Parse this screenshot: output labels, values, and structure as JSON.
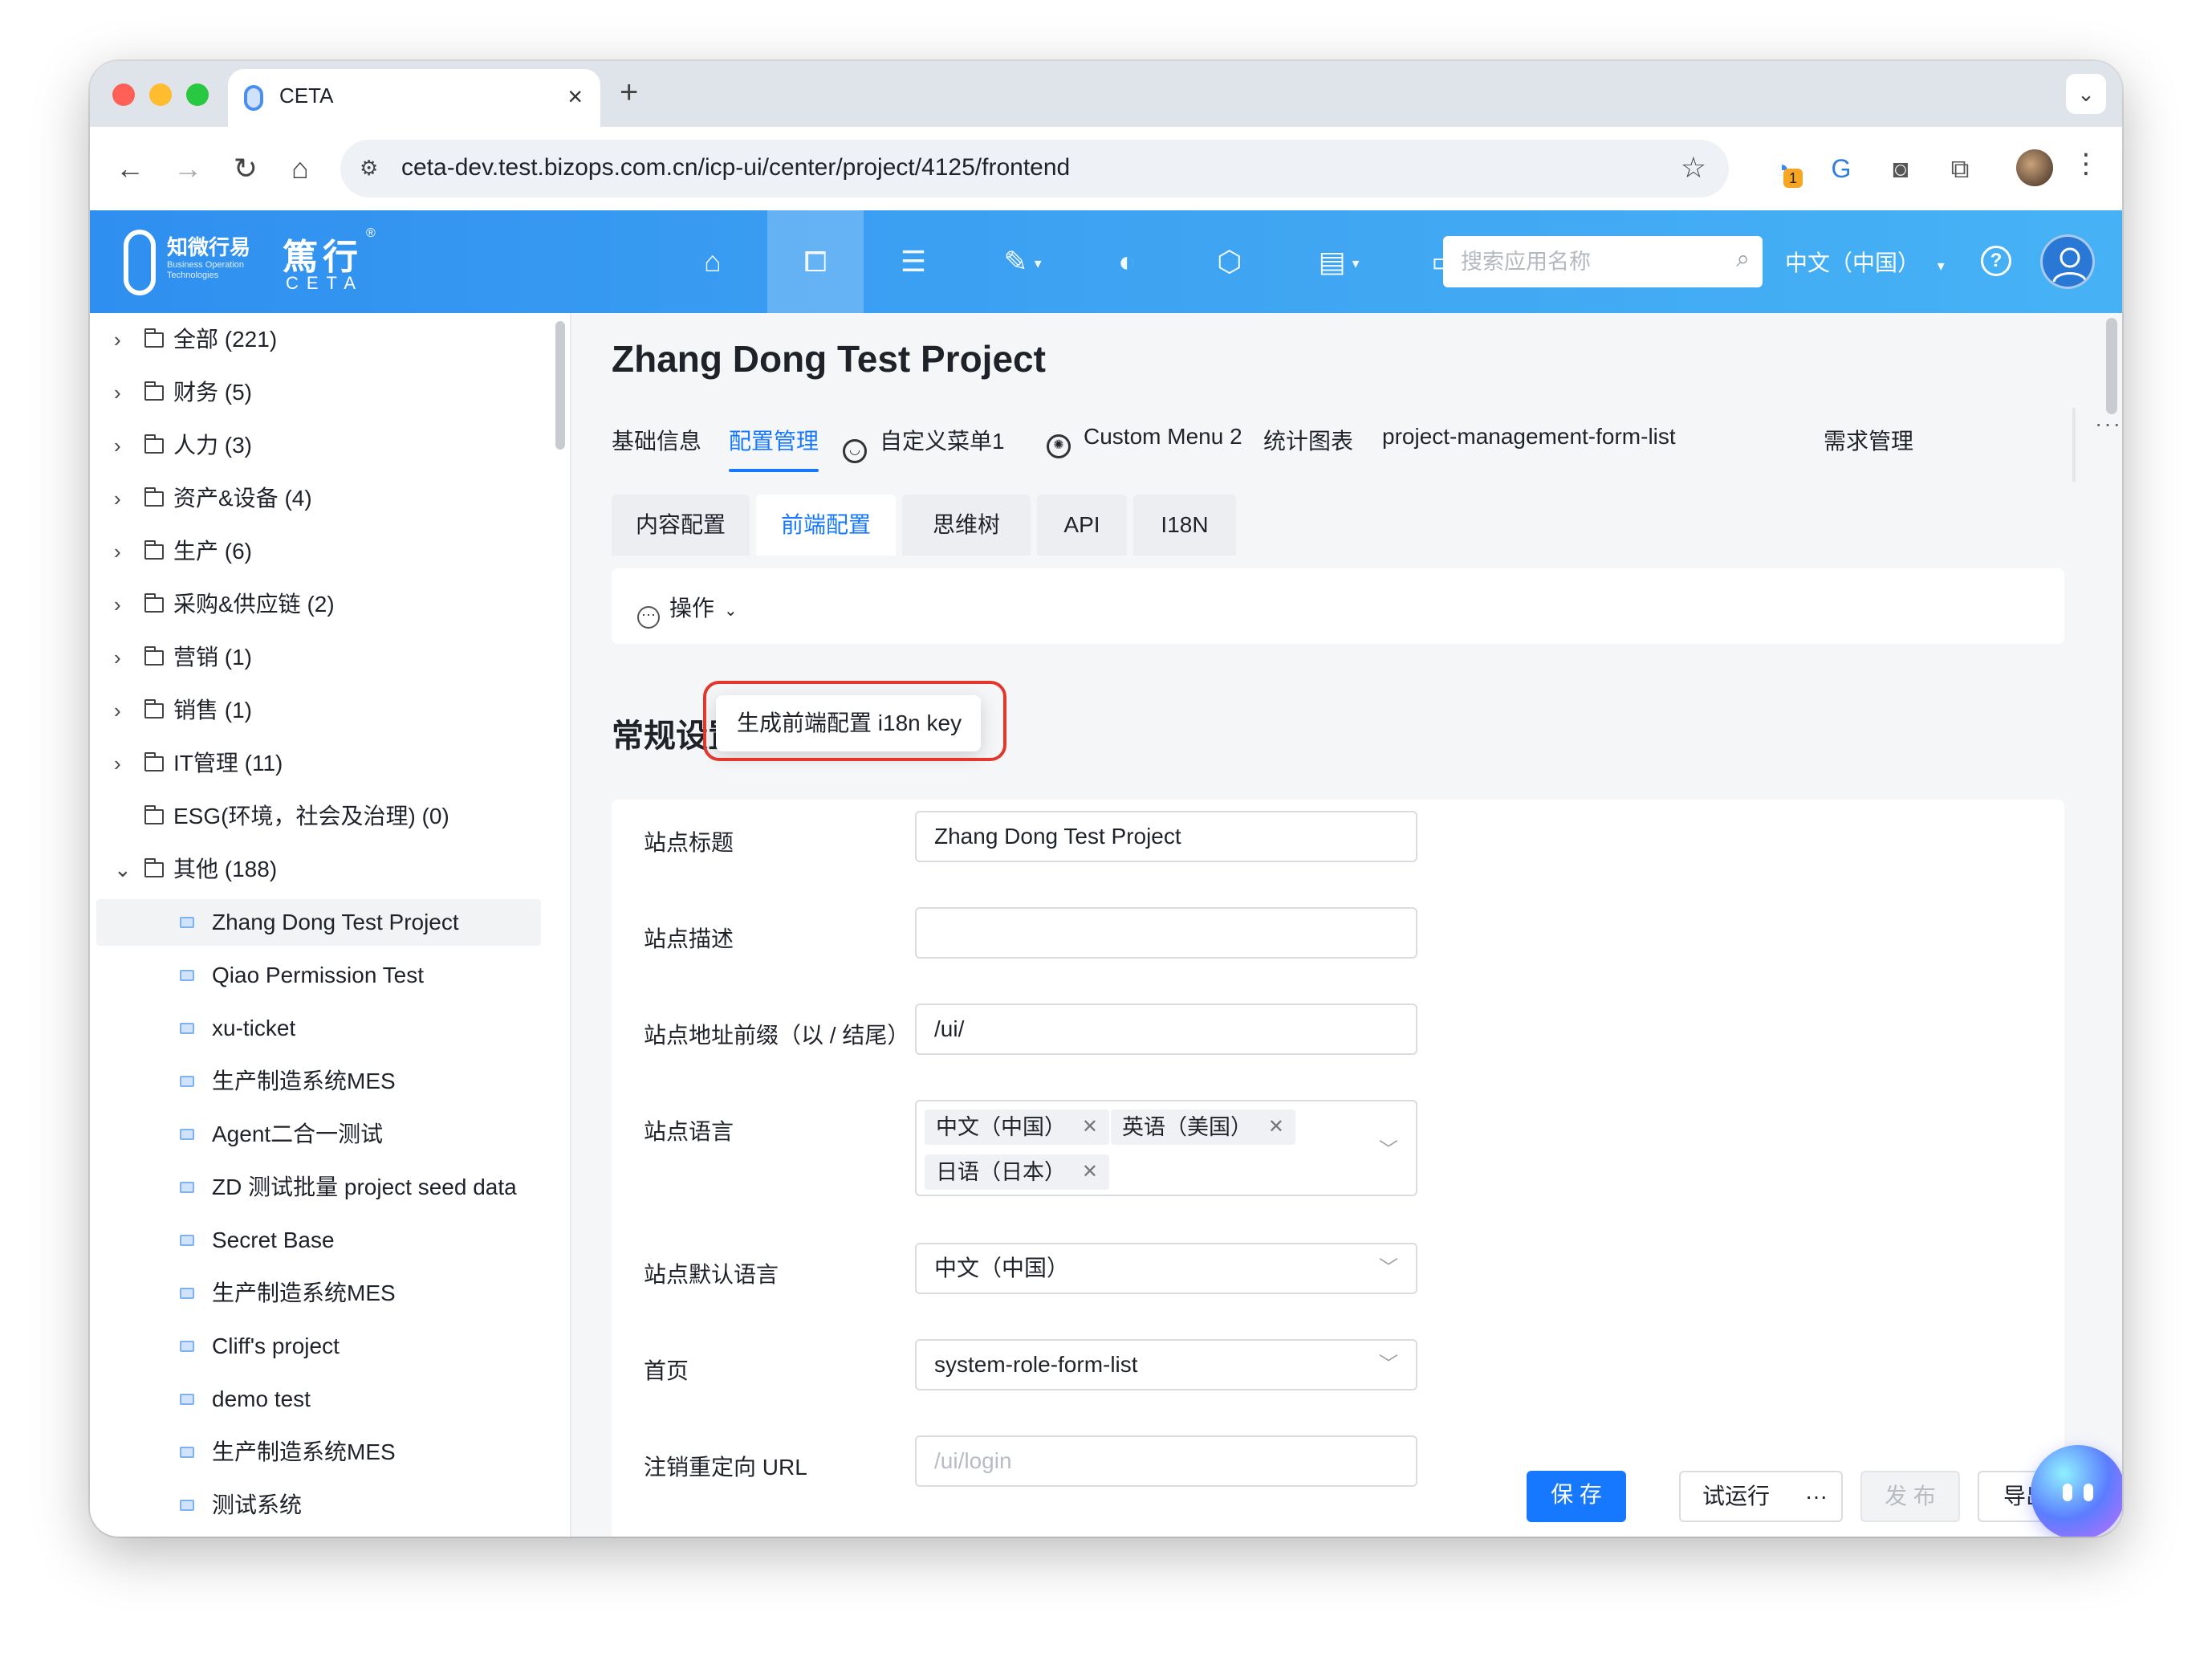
{
  "browser": {
    "tab_title": "CETA",
    "close_glyph": "×",
    "new_tab_glyph": "+",
    "dropdown_glyph": "⌄",
    "url": "ceta-dev.test.bizops.com.cn/icp-ui/center/project/4125/frontend",
    "extension_badge": "1"
  },
  "app": {
    "logo_cn": "知微行易",
    "logo_sub": "Business Operation Technologies",
    "brand_cn": "篤行",
    "brand_en": "CETA",
    "search_placeholder": "搜索应用名称",
    "language": "中文（中国）",
    "help_glyph": "?"
  },
  "sidebar": {
    "categories": [
      {
        "label": "全部 (221)",
        "expanded": false
      },
      {
        "label": "财务 (5)",
        "expanded": false
      },
      {
        "label": "人力 (3)",
        "expanded": false
      },
      {
        "label": "资产&设备 (4)",
        "expanded": false
      },
      {
        "label": "生产 (6)",
        "expanded": false
      },
      {
        "label": "采购&供应链 (2)",
        "expanded": false
      },
      {
        "label": "营销 (1)",
        "expanded": false
      },
      {
        "label": "销售 (1)",
        "expanded": false
      },
      {
        "label": "IT管理 (11)",
        "expanded": false
      },
      {
        "label": "ESG(环境，社会及治理) (0)",
        "expanded": false
      },
      {
        "label": "其他 (188)",
        "expanded": true
      }
    ],
    "projects": [
      "Zhang Dong Test Project",
      "Qiao Permission Test",
      "xu-ticket",
      "生产制造系统MES",
      "Agent二合一测试",
      "ZD 测试批量 project seed data",
      "Secret Base",
      "生产制造系统MES",
      "Cliff's project",
      "demo test",
      "生产制造系统MES",
      "测试系统"
    ],
    "selected_project": "Zhang Dong Test Project"
  },
  "main": {
    "project_title": "Zhang Dong Test Project",
    "tabs": [
      {
        "label": "基础信息"
      },
      {
        "label": "配置管理"
      },
      {
        "label": "自定义菜单1"
      },
      {
        "label": "Custom Menu 2"
      },
      {
        "label": "统计图表"
      },
      {
        "label": "project-management-form-list"
      },
      {
        "label": "需求管理"
      }
    ],
    "active_tab": "配置管理",
    "more_glyph": "···",
    "subtabs": [
      {
        "label": "内容配置"
      },
      {
        "label": "前端配置"
      },
      {
        "label": "思维树"
      },
      {
        "label": "API"
      },
      {
        "label": "I18N"
      }
    ],
    "active_subtab": "前端配置",
    "operations_label": "操作",
    "dropdown_item": "生成前端配置 i18n key",
    "section_title": "常规设置",
    "form": {
      "site_title_label": "站点标题",
      "site_title_value": "Zhang Dong Test Project",
      "site_desc_label": "站点描述",
      "site_desc_value": "",
      "site_prefix_label": "站点地址前缀（以 / 结尾）",
      "site_prefix_value": "/ui/",
      "site_lang_label": "站点语言",
      "site_langs": [
        "中文（中国）",
        "英语（美国）",
        "日语（日本）"
      ],
      "default_lang_label": "站点默认语言",
      "default_lang_value": "中文（中国）",
      "home_label": "首页",
      "home_value": "system-role-form-list",
      "logout_label": "注销重定向 URL",
      "logout_placeholder": "/ui/login"
    },
    "actions": {
      "save": "保 存",
      "trial_run": "试运行",
      "more": "···",
      "publish": "发 布",
      "export": "导出"
    }
  },
  "colors": {
    "primary": "#1677ff",
    "header_start": "#2f8ff0",
    "header_end": "#46b2f5",
    "highlight": "#e2382c"
  }
}
